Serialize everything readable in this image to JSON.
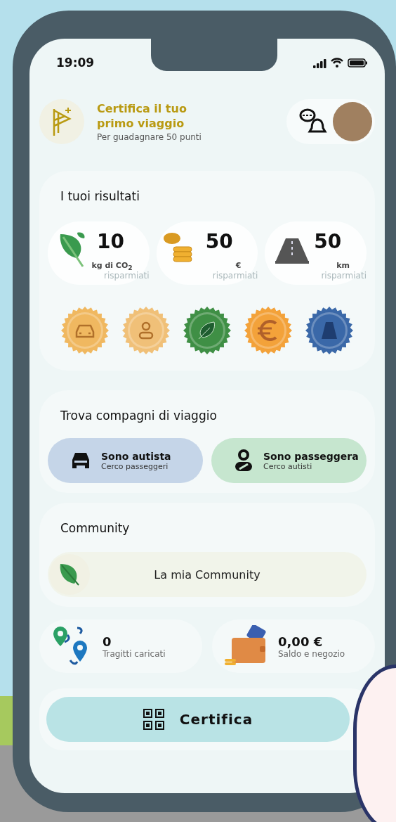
{
  "status_bar": {
    "time": "19:09"
  },
  "header": {
    "title": "Certifica il tuo primo viaggio",
    "subtitle": "Per guadagnare 50 punti"
  },
  "results": {
    "title": "I tuoi risultati",
    "stats": [
      {
        "kind": "co2",
        "value": "10",
        "unit": "kg di CO$_{2}$",
        "label": "risparmiati"
      },
      {
        "kind": "money",
        "value": "50",
        "unit": "€",
        "label": "risparmiati"
      },
      {
        "kind": "road",
        "value": "50",
        "unit": "km",
        "label": "risparmiati"
      }
    ],
    "badges": [
      {
        "kind": "car",
        "color": "#f0b860"
      },
      {
        "kind": "passenger",
        "color": "#f0c078"
      },
      {
        "kind": "leaf",
        "color": "#3f8f45"
      },
      {
        "kind": "euro",
        "color": "#f3a23a"
      },
      {
        "kind": "road",
        "color": "#3a68a8"
      }
    ]
  },
  "companions": {
    "title": "Trova compagni di viaggio",
    "options": [
      {
        "kind": "driver",
        "title": "Sono autista",
        "subtitle": "Cerco passeggeri"
      },
      {
        "kind": "passenger",
        "title": "Sono passeggera",
        "subtitle": "Cerco autisti"
      }
    ]
  },
  "community": {
    "title": "Community",
    "button": "La mia Community"
  },
  "summary": [
    {
      "kind": "trips",
      "value": "0",
      "label": "Tragitti caricati"
    },
    {
      "kind": "wallet",
      "value": "0,00 €",
      "label": "Saldo e negozio"
    }
  ],
  "action": {
    "label": "Certifica"
  }
}
